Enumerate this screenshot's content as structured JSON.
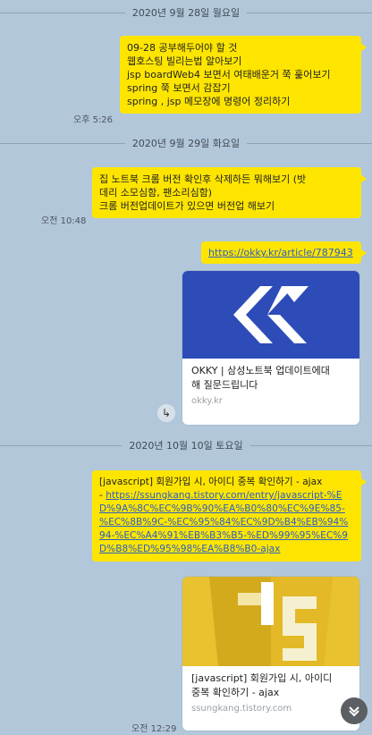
{
  "dates": [
    "2020년 9월 28일 월요일",
    "2020년 9월 29일 화요일",
    "2020년 10월 10일 토요일"
  ],
  "messages": {
    "m1": {
      "lines": [
        "09-28 공부해두어야 할 것",
        "웹호스팅 빌리는법 알아보기",
        "jsp boardWeb4 보면서 여태배운거 쭉 훑어보기",
        "spring 쭉 보면서 감잡기",
        "spring , jsp 메모장에 명령어 정리하기"
      ],
      "time": "오후 5:26"
    },
    "m2": {
      "lines": [
        "집 노트북 크롬 버전 확인후 삭제하든 뭐해보기 (밧",
        "데리 소모심함, 팬소리심함)",
        "크롬 버전업데이트가 있으면 버전업 해보기"
      ],
      "time": "오전 10:48"
    },
    "m3": {
      "link": "https://okky.kr/article/787943",
      "card_title_lines": [
        "OKKY | 삼성노트북 업데이트에대",
        "해 질문드립니다"
      ],
      "card_domain": "okky.kr",
      "share_icon": "↳"
    },
    "m4": {
      "prefix": "[javascript] 회원가입 시, 아이디 중복 확인하기 - ajax",
      "dash": "- ",
      "url_lines": [
        "https://ssungkang.tistory.com/entry/javascript-%E",
        "D%9A%8C%EC%9B%90%EA%B0%80%EC%9E%85-",
        "%EC%8B%9C-%EC%95%84%EC%9D%B4%EB%94%",
        "94-%EC%A4%91%EB%B3%B5-%ED%99%95%EC%9",
        "D%B8%ED%95%98%EA%B8%B0-ajax"
      ],
      "card_title_lines": [
        "[javascript] 회원가입 시, 아이디",
        "중복 확인하기 - ajax"
      ],
      "card_domain": "ssungkang.tistory.com",
      "time": "오전 12:29"
    }
  },
  "scroll_icon": "⌄",
  "colors": {
    "background": "#b2c7da",
    "bubble": "#fee500",
    "okky_brand": "#2d4cb8",
    "js_yellow": "#e8c22f"
  }
}
